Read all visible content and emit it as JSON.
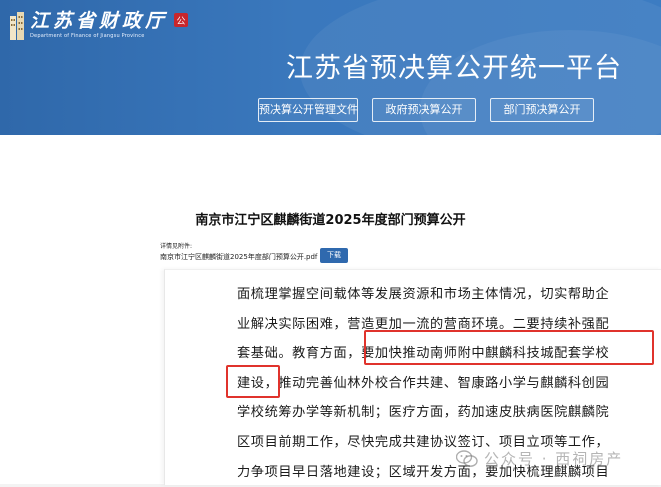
{
  "header": {
    "logo_cn": "江苏省财政厅",
    "logo_en": "Department of Finance of Jiangsu Province",
    "seal": "公",
    "platform_title": "江苏省预决算公开统一平台"
  },
  "nav": [
    {
      "label": "预决算公开管理文件"
    },
    {
      "label": "政府预决算公开"
    },
    {
      "label": "部门预决算公开"
    }
  ],
  "document": {
    "title": "南京市江宁区麒麟街道2025年度部门预算公开",
    "attachment_label": "详情见附件:",
    "attachment_file": "南京市江宁区麒麟街道2025年度部门预算公开.pdf",
    "download_label": "下载"
  },
  "pdf_lines": [
    "面梳理掌握空间载体等发展资源和市场主体情况，切实帮助企",
    "业解决实际困难，营造更加一流的营商环境。二要持续补强配",
    "套基础。教育方面，要加快推动南师附中麒麟科技城配套学校",
    "建设，推动完善仙林外校合作共建、智康路小学与麒麟科创园",
    "学校统筹办学等新机制；医疗方面，药加速皮肤病医院麒麟院",
    "区项目前期工作，尽快完成共建协议签订、项目立项等工作，",
    "力争项目早日落地建设；区域开发方面，要加快梳理麒麟项目"
  ],
  "watermark": "公众号 · 西祠房产",
  "colors": {
    "banner": "#3a78bd",
    "highlight": "#e0332c",
    "download": "#2f69ae"
  }
}
